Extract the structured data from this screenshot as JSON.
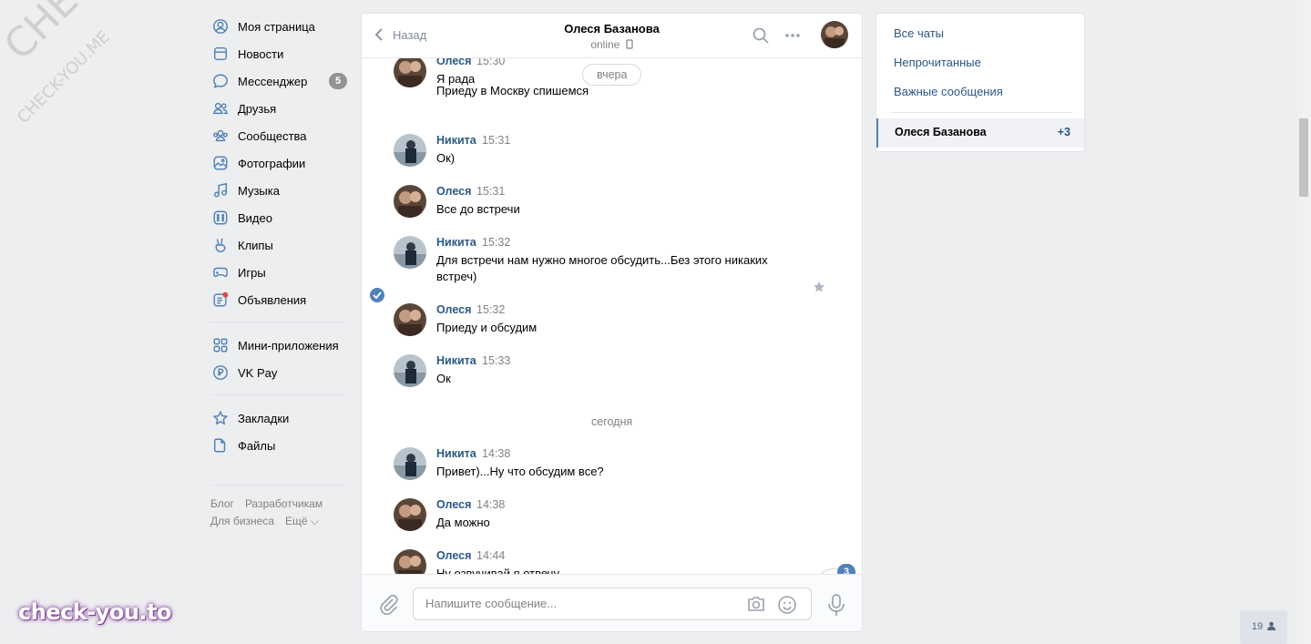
{
  "nav": {
    "items": [
      {
        "label": "Моя страница",
        "icon": "user-icon"
      },
      {
        "label": "Новости",
        "icon": "news-icon"
      },
      {
        "label": "Мессенджер",
        "icon": "messenger-icon",
        "badge": "5"
      },
      {
        "label": "Друзья",
        "icon": "friends-icon"
      },
      {
        "label": "Сообщества",
        "icon": "communities-icon"
      },
      {
        "label": "Фотографии",
        "icon": "photos-icon"
      },
      {
        "label": "Музыка",
        "icon": "music-icon"
      },
      {
        "label": "Видео",
        "icon": "video-icon"
      },
      {
        "label": "Клипы",
        "icon": "clips-icon"
      },
      {
        "label": "Игры",
        "icon": "games-icon"
      },
      {
        "label": "Объявления",
        "icon": "ads-icon"
      }
    ],
    "items2": [
      {
        "label": "Мини-приложения",
        "icon": "apps-icon"
      },
      {
        "label": "VK Pay",
        "icon": "vkpay-icon"
      }
    ],
    "items3": [
      {
        "label": "Закладки",
        "icon": "star-icon"
      },
      {
        "label": "Файлы",
        "icon": "file-icon"
      }
    ],
    "footer": {
      "blog": "Блог",
      "dev": "Разработчикам",
      "biz": "Для бизнеса",
      "more": "Ещё ⌵"
    }
  },
  "chat": {
    "back_label": "Назад",
    "peer_name": "Олеся Базанова",
    "peer_status": "online",
    "day_yesterday": "вчера",
    "day_today": "сегодня",
    "messages": [
      {
        "who": "Олеся",
        "time": "15:30",
        "lines": [
          "Я рада"
        ],
        "sender": "olesya"
      },
      {
        "who": "",
        "time": "",
        "lines": [
          "Приеду в Москву спишемся"
        ],
        "sender": "olesya"
      },
      {
        "who": "Никита",
        "time": "15:31",
        "lines": [
          "Ок)"
        ],
        "sender": "nikita"
      },
      {
        "who": "Олеся",
        "time": "15:31",
        "lines": [
          "Все до встречи"
        ],
        "sender": "olesya"
      },
      {
        "who": "Никита",
        "time": "15:32",
        "lines": [
          "Для встречи нам нужно многое обсудить...Без этого никаких встреч)"
        ],
        "sender": "nikita"
      },
      {
        "who": "Олеся",
        "time": "15:32",
        "lines": [
          "Приеду и обсудим"
        ],
        "sender": "olesya"
      },
      {
        "who": "Никита",
        "time": "15:33",
        "lines": [
          "Ок"
        ],
        "sender": "nikita"
      },
      {
        "who": "Никита",
        "time": "14:38",
        "lines": [
          "Привет)...Ну что обсудим все?"
        ],
        "sender": "nikita"
      },
      {
        "who": "Олеся",
        "time": "14:38",
        "lines": [
          "Да можно"
        ],
        "sender": "olesya"
      },
      {
        "who": "Олеся",
        "time": "14:44",
        "lines": [
          "Ну озвучивай я отвечу"
        ],
        "sender": "olesya"
      }
    ],
    "unread_scroll_badge": "3",
    "composer_placeholder": "Напишите сообщение..."
  },
  "side": {
    "all": "Все чаты",
    "unread": "Непрочитанные",
    "important": "Важные сообщения",
    "active_chat": "Олеся Базанова",
    "active_count": "+3"
  },
  "online_count": "19",
  "watermark": {
    "main": "check-you.to",
    "diag1": "CHECK-YOU.ME",
    "diag2": "CHECK-YOU.ME"
  },
  "colors": {
    "accent": "#5181b8",
    "link": "#2a5885",
    "bg": "#edeef0"
  }
}
